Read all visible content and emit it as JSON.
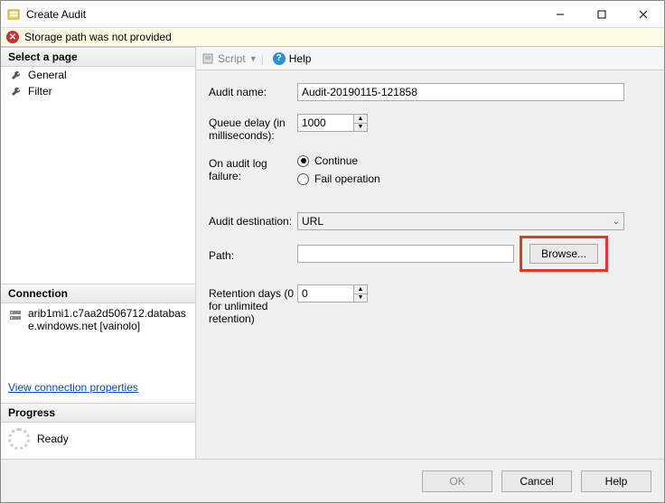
{
  "window": {
    "title": "Create Audit"
  },
  "error": {
    "message": "Storage path was not provided"
  },
  "left": {
    "select_page": "Select a page",
    "pages": [
      "General",
      "Filter"
    ],
    "connection_head": "Connection",
    "connection_text": "arib1mi1.c7aa2d506712.database.windows.net [vainolo]",
    "view_link": "View connection properties",
    "progress_head": "Progress",
    "progress_status": "Ready"
  },
  "toolbar": {
    "script": "Script",
    "help": "Help"
  },
  "form": {
    "audit_name_label": "Audit name:",
    "audit_name_value": "Audit-20190115-121858",
    "queue_delay_label": "Queue delay (in milliseconds):",
    "queue_delay_value": "1000",
    "on_failure_label": "On audit log failure:",
    "on_failure_opt1": "Continue",
    "on_failure_opt2": "Fail operation",
    "dest_label": "Audit destination:",
    "dest_value": "URL",
    "path_label": "Path:",
    "path_value": "",
    "browse": "Browse...",
    "retention_label": "Retention days (0 for unlimited retention)",
    "retention_value": "0"
  },
  "footer": {
    "ok": "OK",
    "cancel": "Cancel",
    "help": "Help"
  }
}
